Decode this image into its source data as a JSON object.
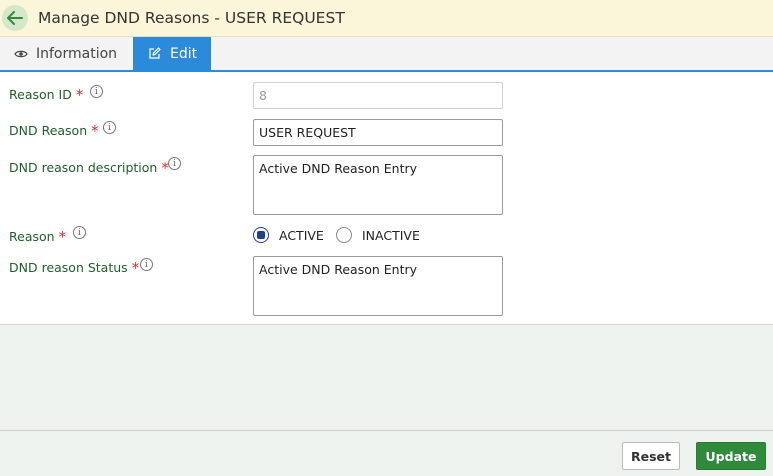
{
  "header": {
    "title": "Manage DND Reasons - USER REQUEST",
    "back_icon": "arrow-left-icon"
  },
  "tabs": [
    {
      "label": "Information",
      "icon": "eye-icon",
      "active": false
    },
    {
      "label": "Edit",
      "icon": "edit-icon",
      "active": true
    }
  ],
  "form": {
    "reason_id": {
      "label": "Reason ID",
      "value": "8",
      "required": "*"
    },
    "dnd_reason": {
      "label": "DND Reason",
      "value": "USER REQUEST",
      "required": "*"
    },
    "description": {
      "label": "DND reason description",
      "value": "Active DND Reason Entry",
      "required": "*"
    },
    "reason": {
      "label": "Reason",
      "required": "*",
      "options": [
        "ACTIVE",
        "INACTIVE"
      ],
      "selected": "ACTIVE"
    },
    "status": {
      "label": "DND reason Status",
      "value": "Active DND Reason Entry",
      "required": "*"
    }
  },
  "actions": {
    "reset_label": "Reset",
    "update_label": "Update"
  },
  "colors": {
    "accent": "#2b8ad9",
    "label": "#1f5f2a",
    "update": "#2f8a3c",
    "required": "#e03131"
  }
}
